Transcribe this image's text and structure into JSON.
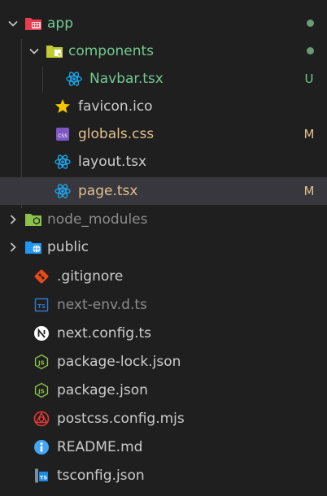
{
  "colors": {
    "untracked": "#73c991",
    "modified": "#e2c08d",
    "ignored": "#8c8c8c",
    "default": "#cccccc",
    "react": "#1fa3e6",
    "selected_bg": "#37373d"
  },
  "explorer": {
    "items": [
      {
        "label": "app",
        "icon": "app-folder-icon",
        "status": ""
      },
      {
        "label": "components",
        "icon": "components-folder-icon",
        "status": ""
      },
      {
        "label": "Navbar.tsx",
        "icon": "react-icon",
        "status": "U"
      },
      {
        "label": "favicon.ico",
        "icon": "star-icon",
        "status": ""
      },
      {
        "label": "globals.css",
        "icon": "css-icon",
        "status": "M"
      },
      {
        "label": "layout.tsx",
        "icon": "react-icon",
        "status": ""
      },
      {
        "label": "page.tsx",
        "icon": "react-icon",
        "status": "M"
      },
      {
        "label": "node_modules",
        "icon": "node-folder-icon",
        "status": ""
      },
      {
        "label": "public",
        "icon": "public-folder-icon",
        "status": ""
      },
      {
        "label": ".gitignore",
        "icon": "git-icon",
        "status": ""
      },
      {
        "label": "next-env.d.ts",
        "icon": "typescript-icon",
        "status": ""
      },
      {
        "label": "next.config.ts",
        "icon": "next-icon",
        "status": ""
      },
      {
        "label": "package-lock.json",
        "icon": "json-icon",
        "status": ""
      },
      {
        "label": "package.json",
        "icon": "json-icon",
        "status": ""
      },
      {
        "label": "postcss.config.mjs",
        "icon": "postcss-icon",
        "status": ""
      },
      {
        "label": "README.md",
        "icon": "info-icon",
        "status": ""
      },
      {
        "label": "tsconfig.json",
        "icon": "tsconfig-icon",
        "status": ""
      }
    ]
  }
}
